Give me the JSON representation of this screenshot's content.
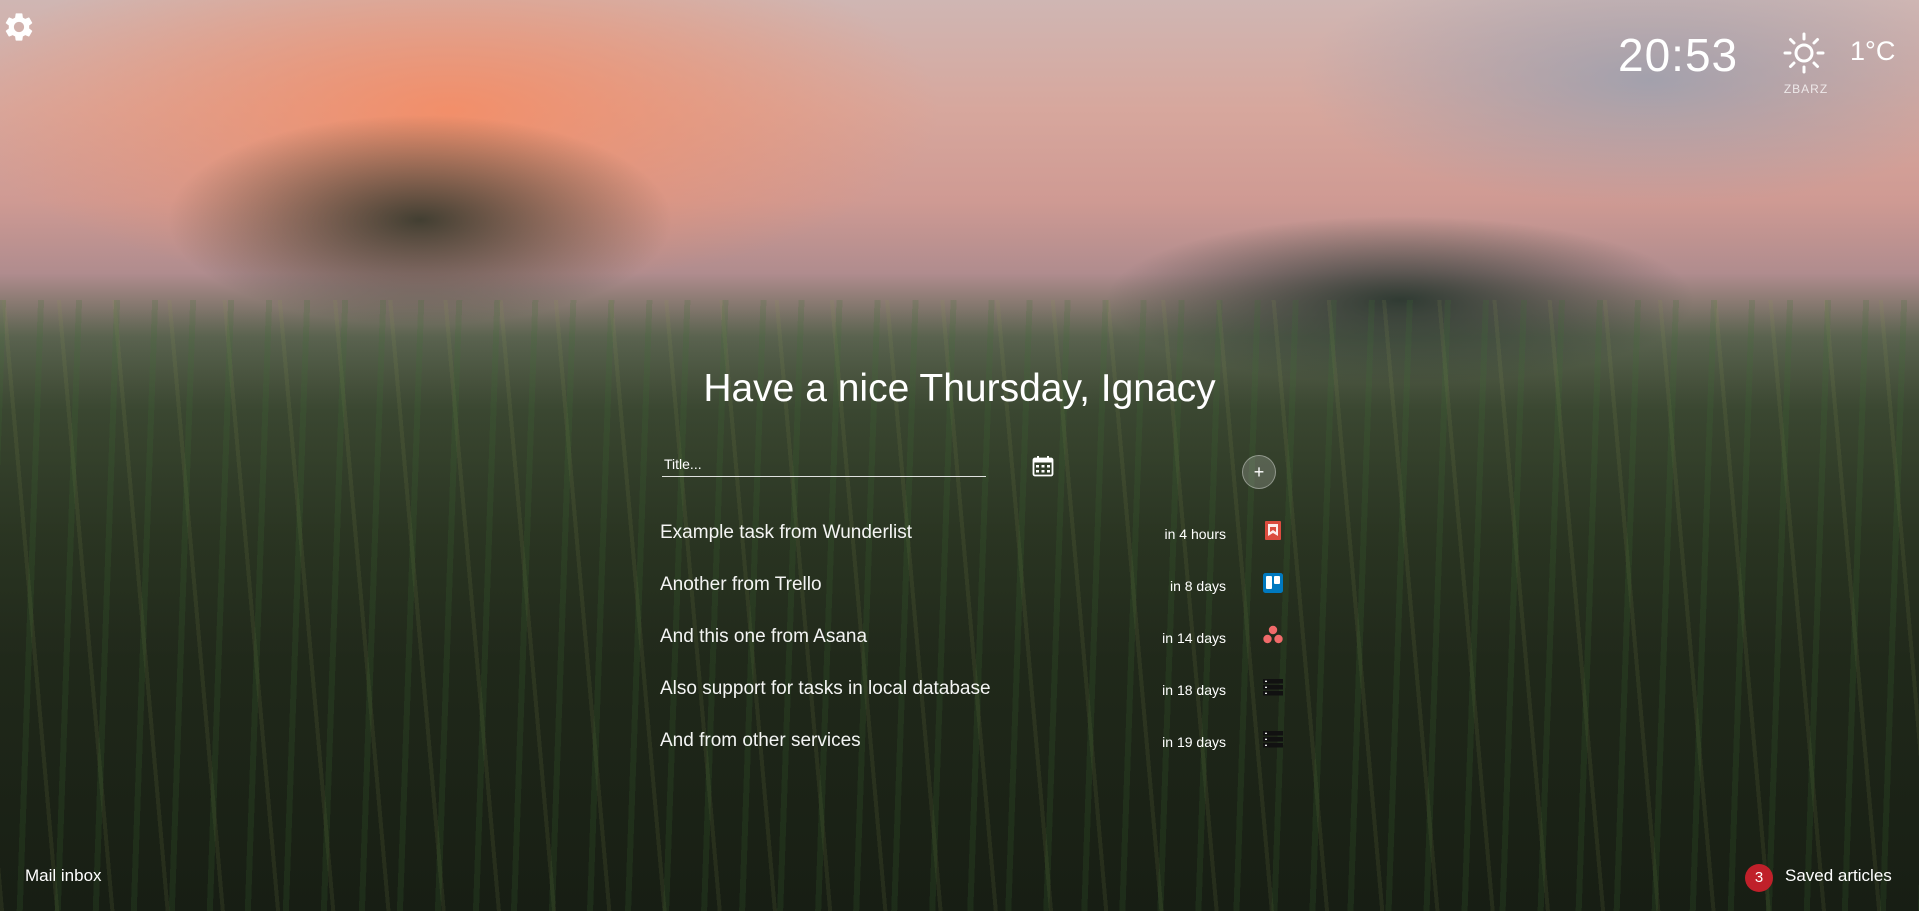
{
  "header": {
    "clock": "20:53",
    "weather": {
      "location": "ZBARZ",
      "temperature": "1°C",
      "icon": "sun-icon"
    }
  },
  "greeting": "Have a nice Thursday, Ignacy",
  "task_form": {
    "title_placeholder": "Title...",
    "add_label": "+"
  },
  "tasks": [
    {
      "title": "Example task from Wunderlist",
      "due": "in 4 hours",
      "source_icon": "wunderlist-icon"
    },
    {
      "title": "Another from Trello",
      "due": "in 8 days",
      "source_icon": "trello-icon"
    },
    {
      "title": "And this one from Asana",
      "due": "in 14 days",
      "source_icon": "asana-icon"
    },
    {
      "title": "Also support for tasks in local database",
      "due": "in 18 days",
      "source_icon": "database-icon"
    },
    {
      "title": "And from other services",
      "due": "in 19 days",
      "source_icon": "database-icon"
    }
  ],
  "footer": {
    "mail_label": "Mail inbox",
    "saved_count": "3",
    "saved_label": "Saved articles"
  },
  "colors": {
    "badge": "#c0202a",
    "wunderlist": "#db4c3f",
    "trello": "#0079bf",
    "asana": "#f06a6a"
  }
}
